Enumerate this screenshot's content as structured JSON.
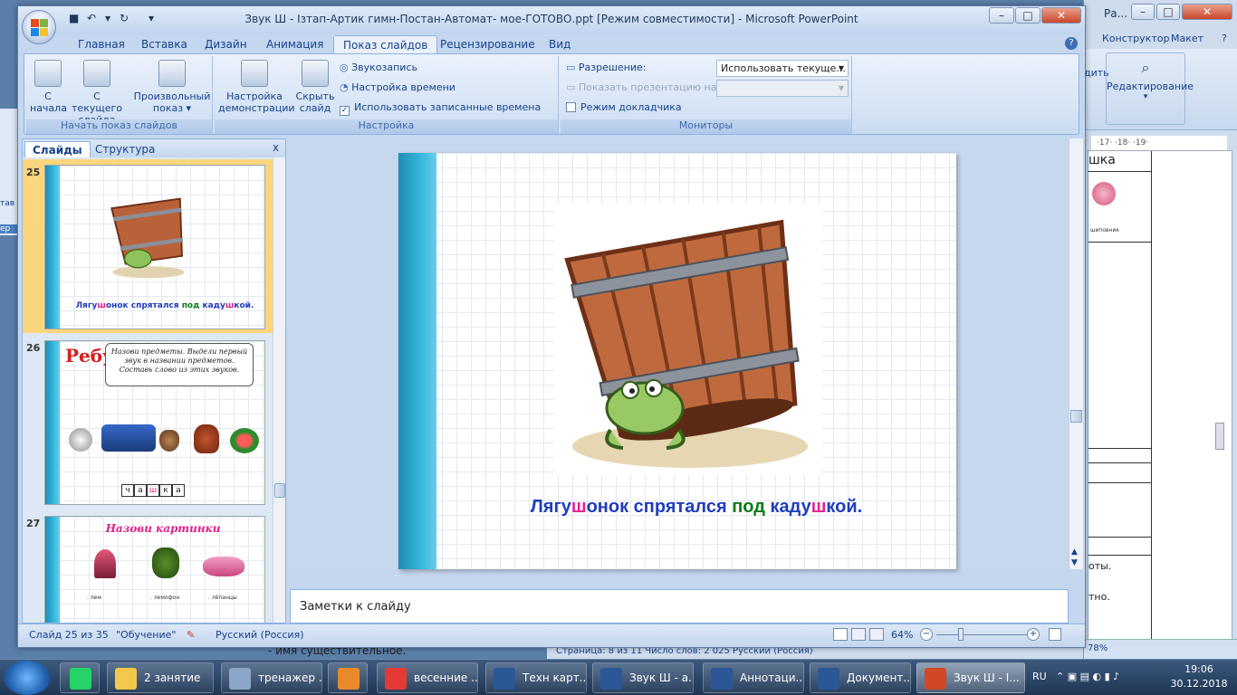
{
  "window": {
    "title": "Звук Ш - Ізтап-Артик гимн-Постан-Автомат- мое-ГОТОВО.ppt [Режим совместимости] - Microsoft PowerPoint",
    "min": "–",
    "max": "□",
    "close": "✕",
    "qat_undo": "↶",
    "qat_redo": "↻",
    "qat_save": "■",
    "qat_more": "▾"
  },
  "tabs": [
    "Главная",
    "Вставка",
    "Дизайн",
    "Анимация",
    "Показ слайдов",
    "Рецензирование",
    "Вид"
  ],
  "help": "?",
  "ribbon": {
    "groups": {
      "start": "Начать показ слайдов",
      "setup": "Настройка",
      "monitors": "Мониторы"
    },
    "from_start_1": "С",
    "from_start_2": "начала",
    "from_current_1": "С текущего",
    "from_current_2": "слайда",
    "custom_1": "Произвольный",
    "custom_2": "показ ▾",
    "setup_show_1": "Настройка",
    "setup_show_2": "демонстрации",
    "hide_1": "Скрыть",
    "hide_2": "слайд",
    "record": "Звукозапись",
    "timing": "Настройка времени",
    "use_timing": "Использовать записанные времена",
    "resolution_label": "Разрешение:",
    "resolution_value": "Использовать текуще...",
    "show_on_label": "Показать презентацию на:",
    "presenter_view": "Режим докладчика"
  },
  "bg_window": {
    "title": "Ра...",
    "tab_constructor": "Конструктор",
    "tab_layout": "Макет",
    "editing": "Редактирование",
    "ruler": "·17· ·18· ·19·",
    "doc_word": "шка",
    "doc_cap": "шиповник",
    "doc_line1": "оты.",
    "doc_line2": "тно.",
    "sb_text": "Страница: 8 из 11   Число слов: 2 025   Русский (Россия)",
    "zoom": "78%",
    "left_item": "тав",
    "left_item2": "ер"
  },
  "bottom_doc_text": "- имя существительное.",
  "panes": {
    "tab_slides": "Слайды",
    "tab_outline": "Структура",
    "close": "x"
  },
  "thumbs": [
    {
      "num": "25",
      "caption_parts": [
        {
          "t": "Лягу",
          "c": "#1f3cbe"
        },
        {
          "t": "ш",
          "c": "#e81f8e"
        },
        {
          "t": "онок спрятался ",
          "c": "#1f3cbe"
        },
        {
          "t": "под ",
          "c": "#0a7d17"
        },
        {
          "t": "каду",
          "c": "#1f3cbe"
        },
        {
          "t": "ш",
          "c": "#e81f8e"
        },
        {
          "t": "кой.",
          "c": "#1f3cbe"
        }
      ]
    },
    {
      "num": "26",
      "title": "Ребу",
      "instructions": "Назови предметы. Выдели первый звук в названии предметов. Составь слово из этих звуков.",
      "letters": [
        "ч",
        "а",
        "ш",
        "к",
        "а"
      ]
    },
    {
      "num": "27",
      "title": "Назови картинки",
      "labels": [
        ". лем",
        ". лемофон",
        ". лёпанцы"
      ]
    }
  ],
  "slide": {
    "caption_parts": [
      {
        "t": "Лягу",
        "c": "#1f3cbe"
      },
      {
        "t": "ш",
        "c": "#e81f8e"
      },
      {
        "t": "онок спрятался ",
        "c": "#1f3cbe"
      },
      {
        "t": "под ",
        "c": "#0a7d17"
      },
      {
        "t": "каду",
        "c": "#1f3cbe"
      },
      {
        "t": "ш",
        "c": "#e81f8e"
      },
      {
        "t": "кой.",
        "c": "#1f3cbe"
      }
    ]
  },
  "notes_placeholder": "Заметки к слайду",
  "status": {
    "slide_of": "Слайд 25 из 35",
    "theme": "\"Обучение\"",
    "lang": "Русский (Россия)",
    "zoom": "64%",
    "minus": "−",
    "plus": "+"
  },
  "taskbar": {
    "items": [
      {
        "label": "",
        "icon": "whatsapp-icon",
        "color": "#25d366"
      },
      {
        "label": "2 занятие",
        "icon": "folder-icon",
        "color": "#f4c84a"
      },
      {
        "label": "тренажер ...",
        "icon": "search-icon",
        "color": "#8aa7c8"
      },
      {
        "label": "",
        "icon": "media-player-icon",
        "color": "#e98a2a"
      },
      {
        "label": "весенние ...",
        "icon": "yandex-icon",
        "color": "#e53935"
      },
      {
        "label": "Техн карт...",
        "icon": "word-icon",
        "color": "#2b5797"
      },
      {
        "label": "Звук Ш - а...",
        "icon": "word-icon",
        "color": "#2b5797"
      },
      {
        "label": "Аннотаци...",
        "icon": "word-icon",
        "color": "#2b5797"
      },
      {
        "label": "Документ...",
        "icon": "word-icon",
        "color": "#2b5797"
      },
      {
        "label": "Звук Ш - І...",
        "icon": "powerpoint-icon",
        "color": "#d24726"
      }
    ],
    "lang": "RU",
    "time": "19:06",
    "date": "30.12.2018"
  }
}
